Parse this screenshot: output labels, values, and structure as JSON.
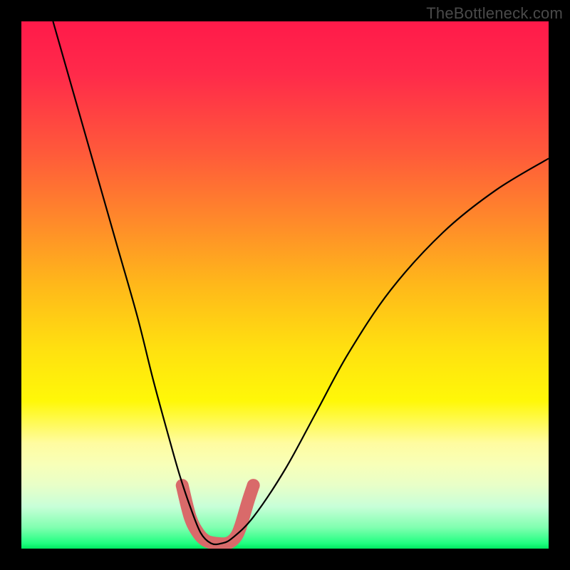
{
  "watermark": "TheBottleneck.com",
  "chart_data": {
    "type": "line",
    "title": "",
    "xlabel": "",
    "ylabel": "",
    "xlim": [
      0,
      100
    ],
    "ylim": [
      0,
      100
    ],
    "series": [
      {
        "name": "bottleneck-curve",
        "x": [
          6,
          10,
          14,
          18,
          22,
          25,
          28,
          30,
          32,
          34,
          36,
          38,
          40,
          44,
          50,
          56,
          62,
          70,
          80,
          90,
          100
        ],
        "y": [
          100,
          86,
          72,
          58,
          44,
          32,
          21,
          14,
          8,
          3,
          1,
          1,
          2,
          6,
          15,
          26,
          37,
          49,
          60,
          68,
          74
        ]
      }
    ],
    "markers": {
      "name": "highlight-segment",
      "color": "#d96a6a",
      "x": [
        30.5,
        32,
        33.5,
        35,
        37,
        39,
        40.5,
        41.5,
        43,
        44
      ],
      "y": [
        12,
        6,
        3,
        1.5,
        1,
        1,
        2,
        4,
        9,
        12
      ]
    }
  }
}
